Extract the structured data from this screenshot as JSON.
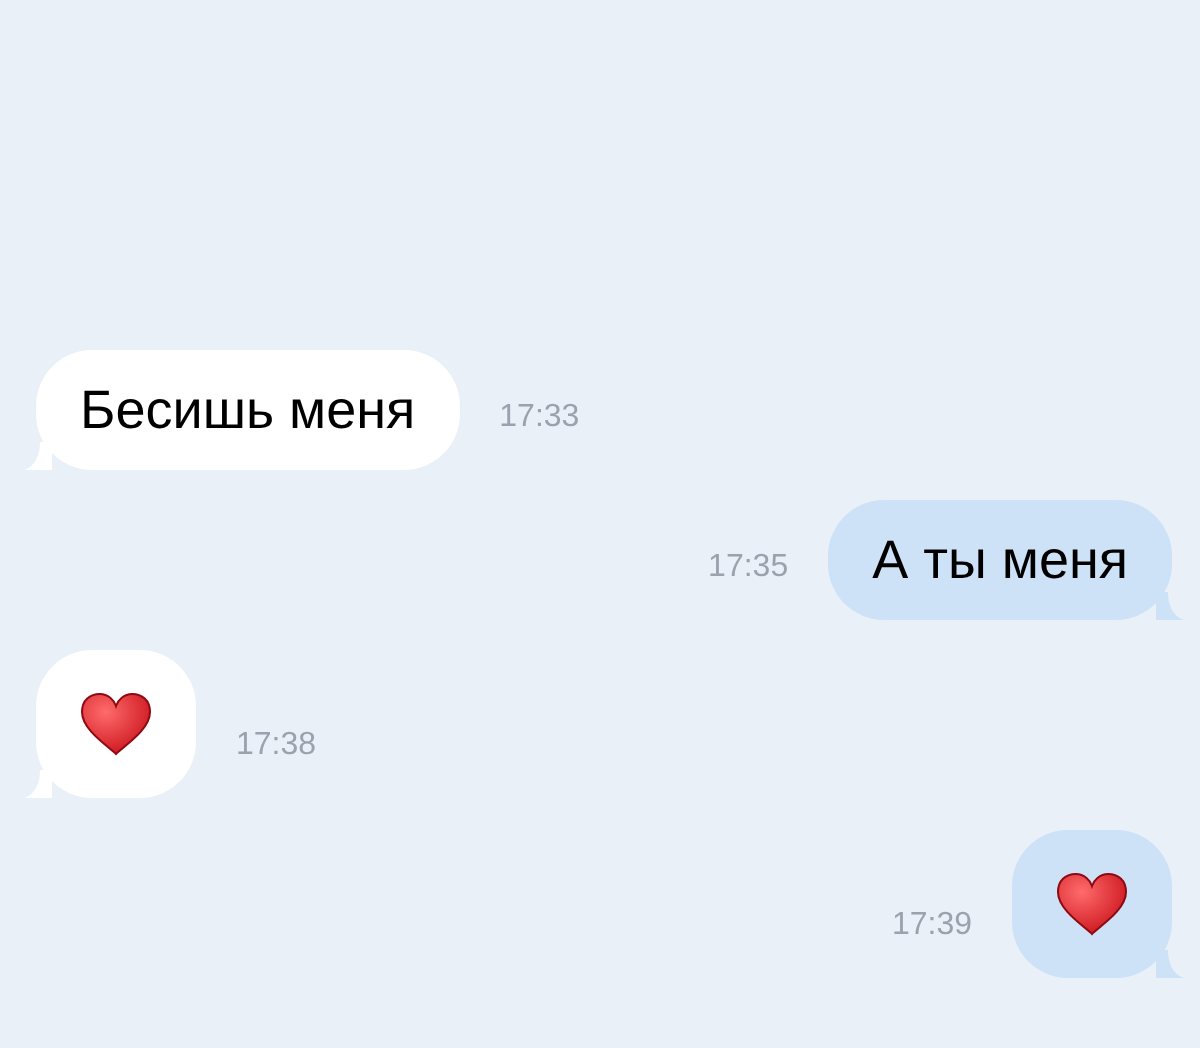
{
  "messages": [
    {
      "kind": "text",
      "outgoing": false,
      "text": "Бесишь меня",
      "time": "17:33"
    },
    {
      "kind": "text",
      "outgoing": true,
      "text": "А ты меня",
      "time": "17:35"
    },
    {
      "kind": "heart",
      "outgoing": false,
      "time": "17:38"
    },
    {
      "kind": "heart",
      "outgoing": true,
      "time": "17:39"
    }
  ]
}
